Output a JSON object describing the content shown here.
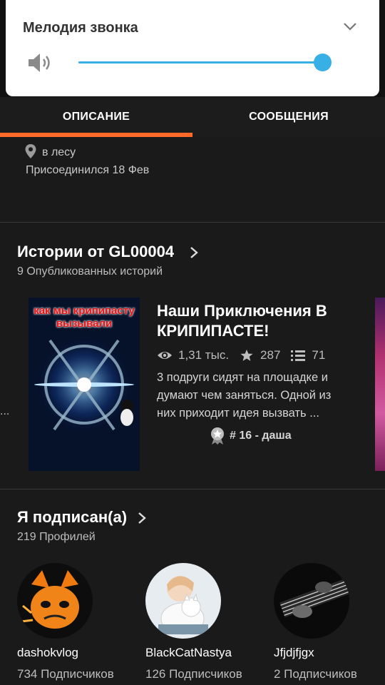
{
  "volume_panel": {
    "title": "Мелодия звонка",
    "level": 1.0,
    "accent_color": "#38b0e6",
    "icons": [
      "speaker-icon",
      "chevron-down-icon"
    ]
  },
  "tabs": [
    {
      "label": "ОПИСАНИЕ",
      "active": true
    },
    {
      "label": "СООБЩЕНИЯ",
      "active": false
    }
  ],
  "profile": {
    "location": "в лесу",
    "joined": "Присоединился 18 Фев"
  },
  "stories_section": {
    "title": "Истории от GL00004",
    "count": "9 Опубликованных историй",
    "story": {
      "cover_text": "как мы крипипасту вызывали",
      "title": "Наши Приключения В КРИПИПАСТЕ!",
      "views": "1,31 тыс.",
      "votes": "287",
      "parts": "71",
      "description": "3 подруги сидят на площадке и думают чем заняться. Одной из них приходит идея вызвать ...",
      "ranking": "# 16 - даша"
    },
    "left_ellipsis": "..."
  },
  "following_section": {
    "title": "Я подписан(а)",
    "count": "219 Профилей",
    "profiles": [
      {
        "name": "dashokvlog",
        "followers": "734 Подписчиков"
      },
      {
        "name": "BlackCatNastya",
        "followers": "126 Подписчиков"
      },
      {
        "name": "Jfjdjfjgx",
        "followers": "2 Подписчиков"
      }
    ]
  },
  "colors": {
    "background": "#1a1a1b",
    "tab_indicator": "#ff6a2b"
  }
}
